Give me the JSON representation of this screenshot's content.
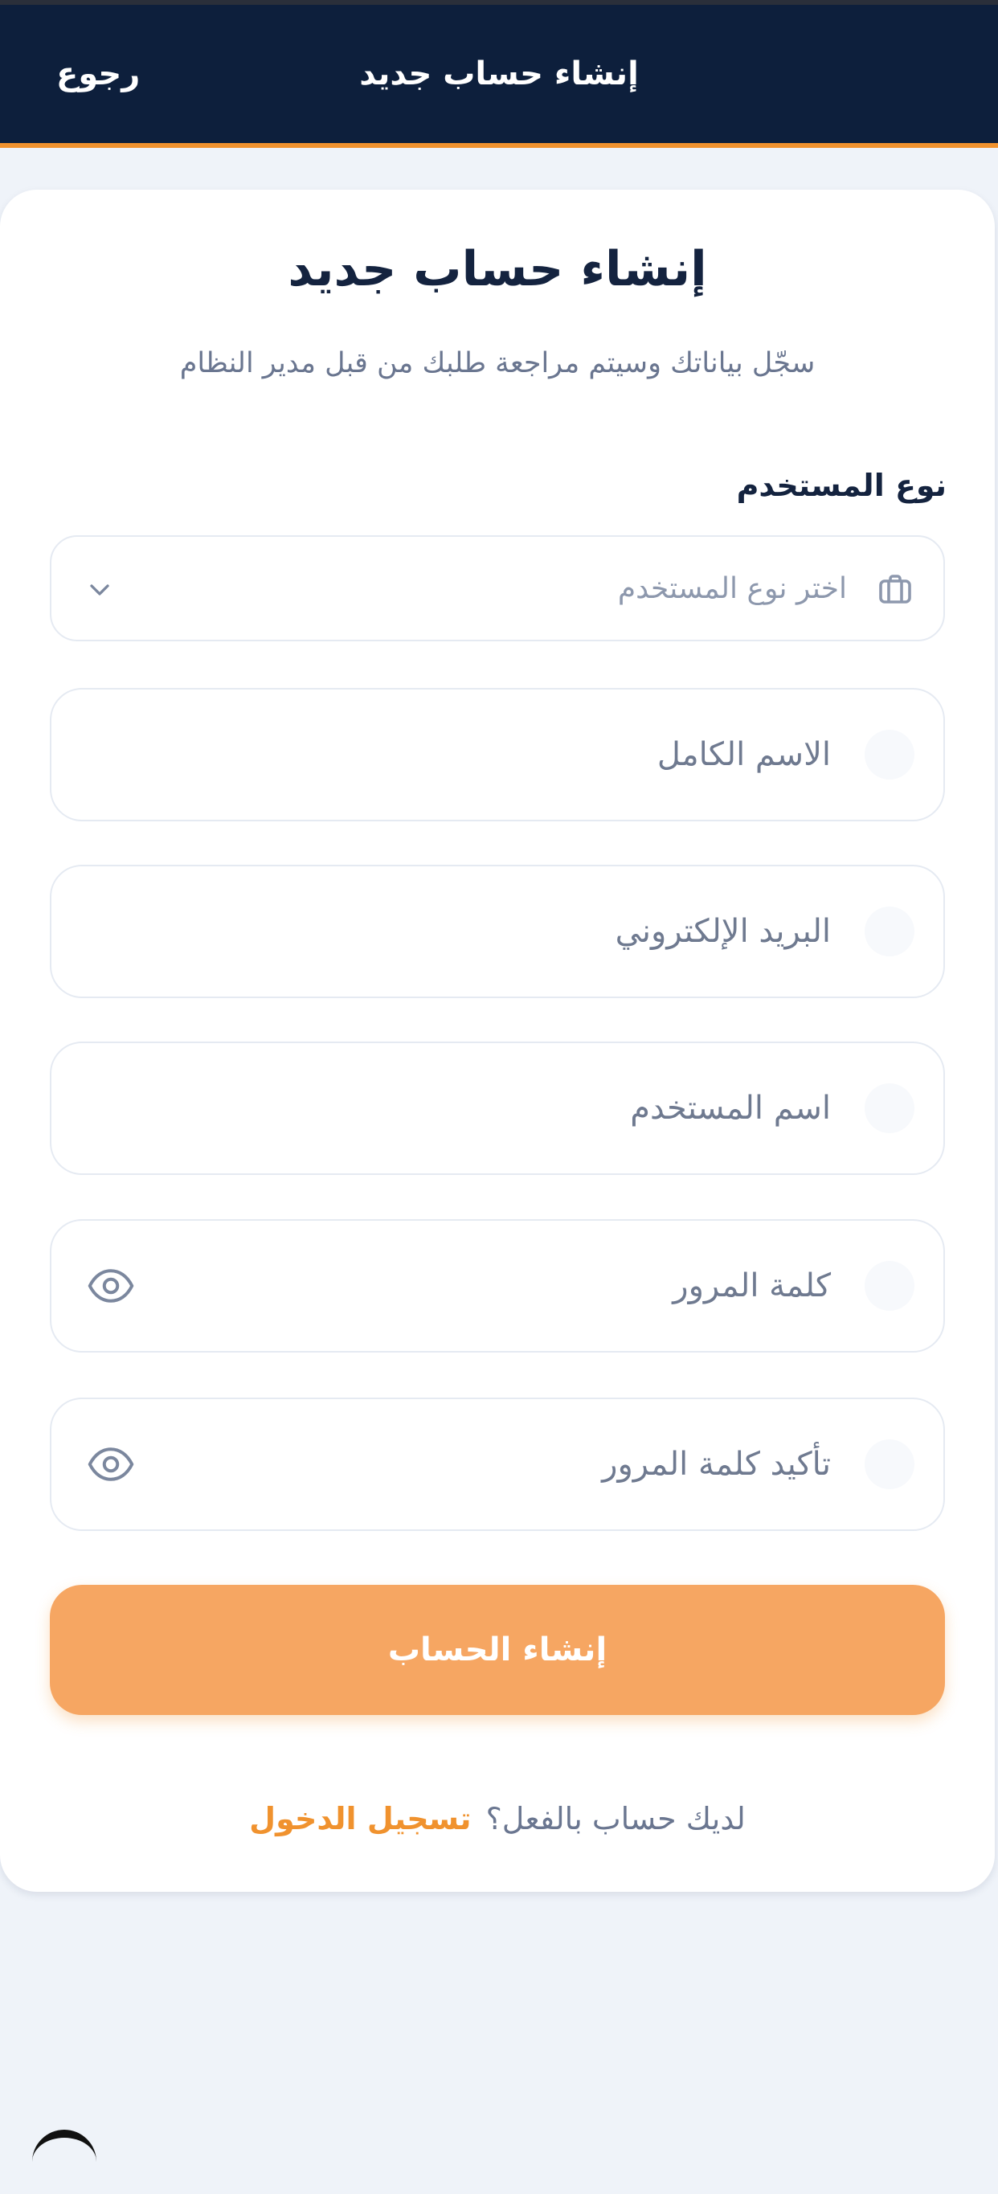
{
  "header": {
    "title": "إنشاء حساب جديد",
    "back_label": "رجوع"
  },
  "card": {
    "title": "إنشاء حساب جديد",
    "subtitle": "سجّل بياناتك وسيتم مراجعة طلبك من قبل مدير النظام"
  },
  "user_type": {
    "label": "نوع المستخدم",
    "placeholder": "اختر نوع المستخدم",
    "icon": "briefcase-icon"
  },
  "fields": {
    "full_name": {
      "placeholder": "الاسم الكامل"
    },
    "email": {
      "placeholder": "البريد الإلكتروني"
    },
    "username": {
      "placeholder": "اسم المستخدم"
    },
    "password": {
      "placeholder": "كلمة المرور"
    },
    "confirm_password": {
      "placeholder": "تأكيد كلمة المرور"
    }
  },
  "submit": {
    "label": "إنشاء الحساب"
  },
  "footer": {
    "question": "لديك حساب بالفعل؟",
    "login_link": "تسجيل الدخول"
  },
  "colors": {
    "header_bg": "#0d1f3c",
    "accent": "#f0922e",
    "button_bg": "#f6a662",
    "page_bg": "#eff3f9"
  }
}
